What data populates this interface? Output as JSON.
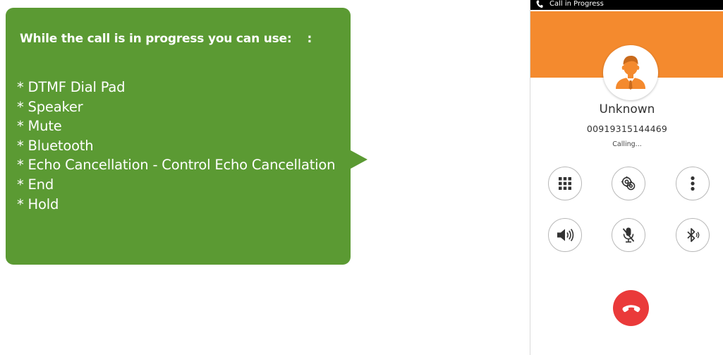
{
  "callout": {
    "title": "While the call is in progress you can use:",
    "title_suffix": ":",
    "items": [
      "* DTMF Dial Pad",
      "* Speaker",
      "* Mute",
      "* Bluetooth",
      "* Echo Cancellation - Control Echo Cancellation",
      "* End",
      "* Hold"
    ],
    "color": "#5b9a33"
  },
  "phone": {
    "status_bar": {
      "icon": "phone-icon",
      "text": "Call in Progress"
    },
    "header_color": "#f48a2e",
    "avatar_icon": "person-avatar-icon",
    "caller": {
      "name": "Unknown",
      "number": "00919315144469",
      "status": "Calling..."
    },
    "controls": [
      {
        "icon": "dialpad-icon"
      },
      {
        "icon": "echo-cancellation-icon"
      },
      {
        "icon": "more-vertical-icon"
      },
      {
        "icon": "speaker-icon"
      },
      {
        "icon": "mute-microphone-icon"
      },
      {
        "icon": "bluetooth-icon"
      }
    ],
    "end_call": {
      "icon": "end-call-icon",
      "color": "#ea3a3a"
    }
  }
}
